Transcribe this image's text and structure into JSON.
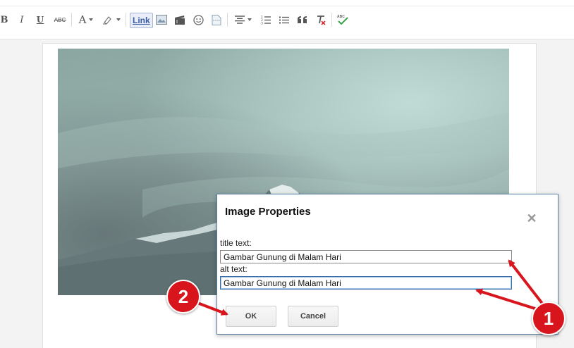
{
  "toolbar": {
    "bold": "B",
    "italic": "I",
    "underline": "U",
    "strike": "ABC",
    "font_color": "A",
    "link": "Link",
    "spellcheck": "ABC"
  },
  "dialog": {
    "title": "Image Properties",
    "close": "✕",
    "title_label": "title text:",
    "title_value": "Gambar Gunung di Malam Hari",
    "alt_label": "alt text:",
    "alt_value": "Gambar Gunung di Malam Hari",
    "ok": "OK",
    "cancel": "Cancel"
  },
  "annotations": {
    "badge_1": "1",
    "badge_2": "2"
  },
  "colors": {
    "annotation_red": "#d8141c",
    "dialog_border": "#5b7fa0",
    "link_blue": "#3d5fa8"
  },
  "icons": [
    "bold-icon",
    "italic-icon",
    "underline-icon",
    "strikethrough-icon",
    "font-color-icon",
    "highlight-icon",
    "link-icon",
    "image-icon",
    "video-icon",
    "emoji-icon",
    "jump-break-icon",
    "align-icon",
    "numbered-list-icon",
    "bullet-list-icon",
    "quote-icon",
    "clear-formatting-icon",
    "spellcheck-icon"
  ]
}
